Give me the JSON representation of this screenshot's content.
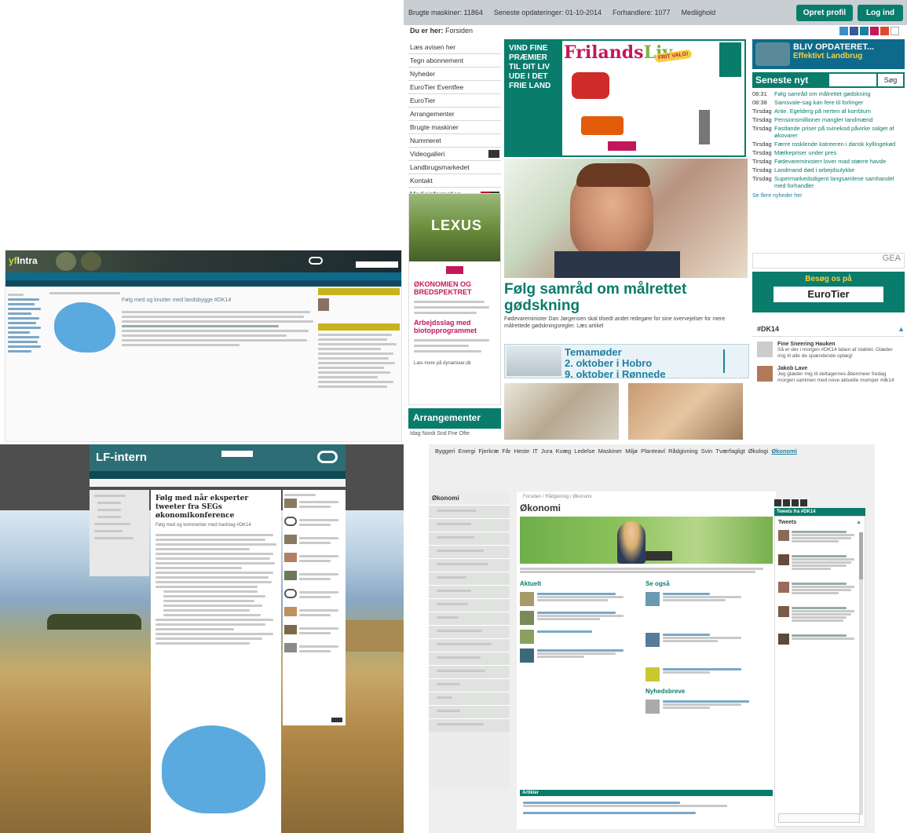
{
  "panel1": {
    "stats": [
      {
        "label": "Brugte maskiner: 11864"
      },
      {
        "label": "Seneste opdateringer: 01-10-2014"
      },
      {
        "label": "Forhandlere: 1077"
      },
      {
        "label": "Medlighold"
      }
    ],
    "buttons": {
      "create_profile": "Opret profil",
      "login": "Log ind"
    },
    "breadcrumb": {
      "prefix": "Du er her:",
      "current": "Forsiden"
    },
    "left_nav": [
      "Læs avisen her",
      "Tegn abonnement",
      "Nyheder",
      "EuroTier Eventfee",
      "EuroTier",
      "Arrangementer",
      "Brugte maskiner",
      "Nummeret",
      "Videogalleri",
      "Landbrugsmarkedet",
      "Kontakt",
      "Medieinformation"
    ],
    "ad": {
      "green_text": "VIND FINE PRÆMIER TIL DIT LIV UDE I DET FRIE LAND",
      "brand": "Frilands",
      "brand_accent": "Liv",
      "badge": "FRIT VALG!"
    },
    "headline": "Følg samråd om målrettet gødskning",
    "lede": "Fødevareminister Dan Jørgensen skal tilsedt andet redegøre for sine overvejelser for mere målrettede gødskningsregler. Læs artikel",
    "banner": {
      "line1": "Temamøder",
      "line2": "2. oktober i Hobro",
      "line3": "9. oktober i Rønnede"
    },
    "lexus_ad": {
      "brand": "LEXUS",
      "red_title": "ØKONOMIEN OG BREDSPEKTRET",
      "offer": "Arbejdsslag med biotop­programmet",
      "footer": "Læs mere på dynamiaer.dk"
    },
    "arrangementer": "Arrangementer",
    "days": "Idag  Nordi  Snd  Fne  Ofte",
    "bliv": {
      "title": "BLIV OPDATERET...",
      "sub": "Effektivt Landbrug"
    },
    "seneste": {
      "title": "Seneste nyt",
      "search_button": "Søg"
    },
    "news": [
      {
        "time": "08:31",
        "title": "Følg samråd om målrettet gødskning"
      },
      {
        "time": "08:38",
        "title": "Samsvale-sag kan fere til forlinger"
      },
      {
        "time": "Tirsdag",
        "title": "Ante. Egelderg på nerten af korrblum"
      },
      {
        "time": "Tirsdag",
        "title": "Pensionsmillioner mangler landmænd"
      },
      {
        "time": "Tirsdag",
        "title": "Fastlande priser på svinekod påvirke salget af økovarer"
      },
      {
        "time": "Tirsdag",
        "title": "Færre rosklende katreeren i dansk kyllingekød"
      },
      {
        "time": "Tirsdag",
        "title": "Mælkepriser under pres"
      },
      {
        "time": "Tirsdag",
        "title": "Fødevareministerr lover mad stærre havde"
      },
      {
        "time": "Tirsdag",
        "title": "Landmand død i arbejdsulykke"
      },
      {
        "time": "Tirsdag",
        "title": "Supermarkedsdigent langsamlene samhandel med forhandler"
      }
    ],
    "se_flere": "Se flere nyheder her",
    "gea": "GEA",
    "eurotier": {
      "visit": "Besøg os på",
      "logo": "EuroTier"
    },
    "twitter": {
      "header": "#DK14",
      "tweets": [
        {
          "name": "Fine Sneering Hauken",
          "text": "Så er der i morgen #DK14 laben af stablet. Glæder mig til alle de spændende oplæg!"
        },
        {
          "name": "Jakob Lave",
          "text": "Jeg glæder mig til deltagernes åbenmeer fredag morgen sammen med nove aktuelle momper #dk14"
        }
      ]
    }
  },
  "panel2": {
    "logo_a": "yf",
    "logo_b": "Intra",
    "title_line": "Følg med og knutter med landsbygge #DK14"
  },
  "panel3": {
    "logo": "LF-intern",
    "title": "Følg med når eksperter tweeter fra SEGs økonomikonference",
    "subtitle": "Følg med og kommenter med hashtag #DK14"
  },
  "panel4": {
    "topnav_items": [
      "Byggeri",
      "Energi",
      "Fjerkræ",
      "Får",
      "Heste",
      "IT",
      "Jura",
      "Kvæg",
      "Ledelse",
      "Maskiner",
      "Miljø",
      "Planteavl",
      "Rådgivning",
      "Svin",
      "Tværfagligt",
      "Økologi"
    ],
    "topnav_active": "Økonomi",
    "side_title": "Økonomi",
    "heading": "Økonomi",
    "breadcrumb": "Forsiden / Rådgivning / Økonomi",
    "aktuelt": "Aktuelt",
    "se_ogsaa": "Se også",
    "nyhedsbreve": "Nyhedsbreve",
    "twitter_bar": "Tweets fra #DK14",
    "tweets_header": "Tweets",
    "artikler": "Artikler"
  },
  "colors": {
    "accent": "#0a7c6b",
    "blue": "#1e7fa3",
    "magenta": "#c2185b",
    "topbar": "#c9ced3",
    "yellow": "#f4d03f"
  }
}
